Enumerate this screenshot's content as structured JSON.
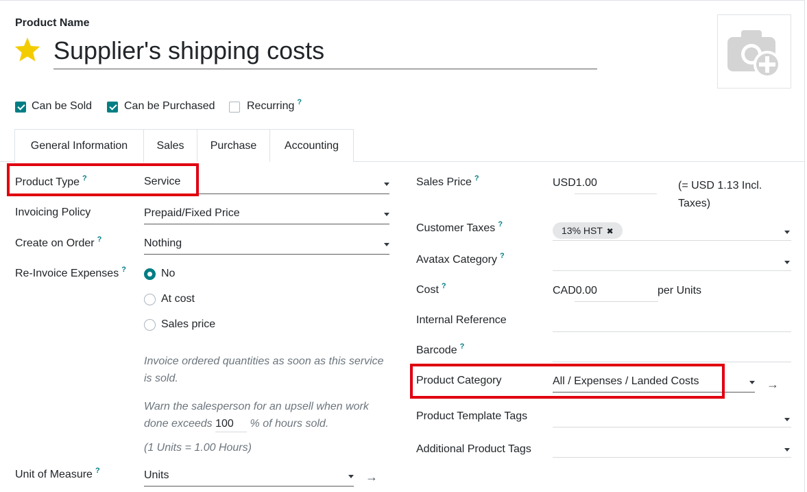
{
  "header": {
    "product_name_label": "Product Name",
    "product_name_value": "Supplier's shipping costs"
  },
  "checks": [
    {
      "label": "Can be Sold",
      "checked": true
    },
    {
      "label": "Can be Purchased",
      "checked": true
    },
    {
      "label": "Recurring",
      "checked": false,
      "help": "?"
    }
  ],
  "tabs": [
    "General Information",
    "Sales",
    "Purchase",
    "Accounting"
  ],
  "left": {
    "product_type": {
      "label": "Product Type",
      "help": "?",
      "value": "Service"
    },
    "invoicing_policy": {
      "label": "Invoicing Policy",
      "value": "Prepaid/Fixed Price"
    },
    "create_on_order": {
      "label": "Create on Order",
      "help": "?",
      "value": "Nothing"
    },
    "reinvoice": {
      "label": "Re-Invoice Expenses",
      "help": "?",
      "options": [
        "No",
        "At cost",
        "Sales price"
      ],
      "selected": "No"
    },
    "note1": "Invoice ordered quantities as soon as this service is sold.",
    "note2_a": "Warn the salesperson for an upsell when work done exceeds",
    "note2_value": "100",
    "note2_b": "% of hours sold.",
    "note3": "(1 Units = 1.00 Hours)",
    "uom": {
      "label": "Unit of Measure",
      "help": "?",
      "value": "Units"
    }
  },
  "right": {
    "sales_price": {
      "label": "Sales Price",
      "help": "?",
      "value": "USD1.00",
      "incl": "(= USD 1.13 Incl. Taxes)"
    },
    "customer_taxes": {
      "label": "Customer Taxes",
      "help": "?",
      "tag": "13% HST"
    },
    "avatax": {
      "label": "Avatax Category",
      "help": "?"
    },
    "cost": {
      "label": "Cost",
      "help": "?",
      "value": "CAD0.00",
      "unit": "per Units"
    },
    "internal_ref": {
      "label": "Internal Reference"
    },
    "barcode": {
      "label": "Barcode",
      "help": "?"
    },
    "category": {
      "label": "Product Category",
      "value": "All / Expenses / Landed Costs"
    },
    "template_tags": {
      "label": "Product Template Tags"
    },
    "additional_tags": {
      "label": "Additional Product Tags"
    }
  },
  "colors": {
    "accent": "#017e84",
    "highlight": "#e0000f",
    "star": "#f3cc00"
  }
}
